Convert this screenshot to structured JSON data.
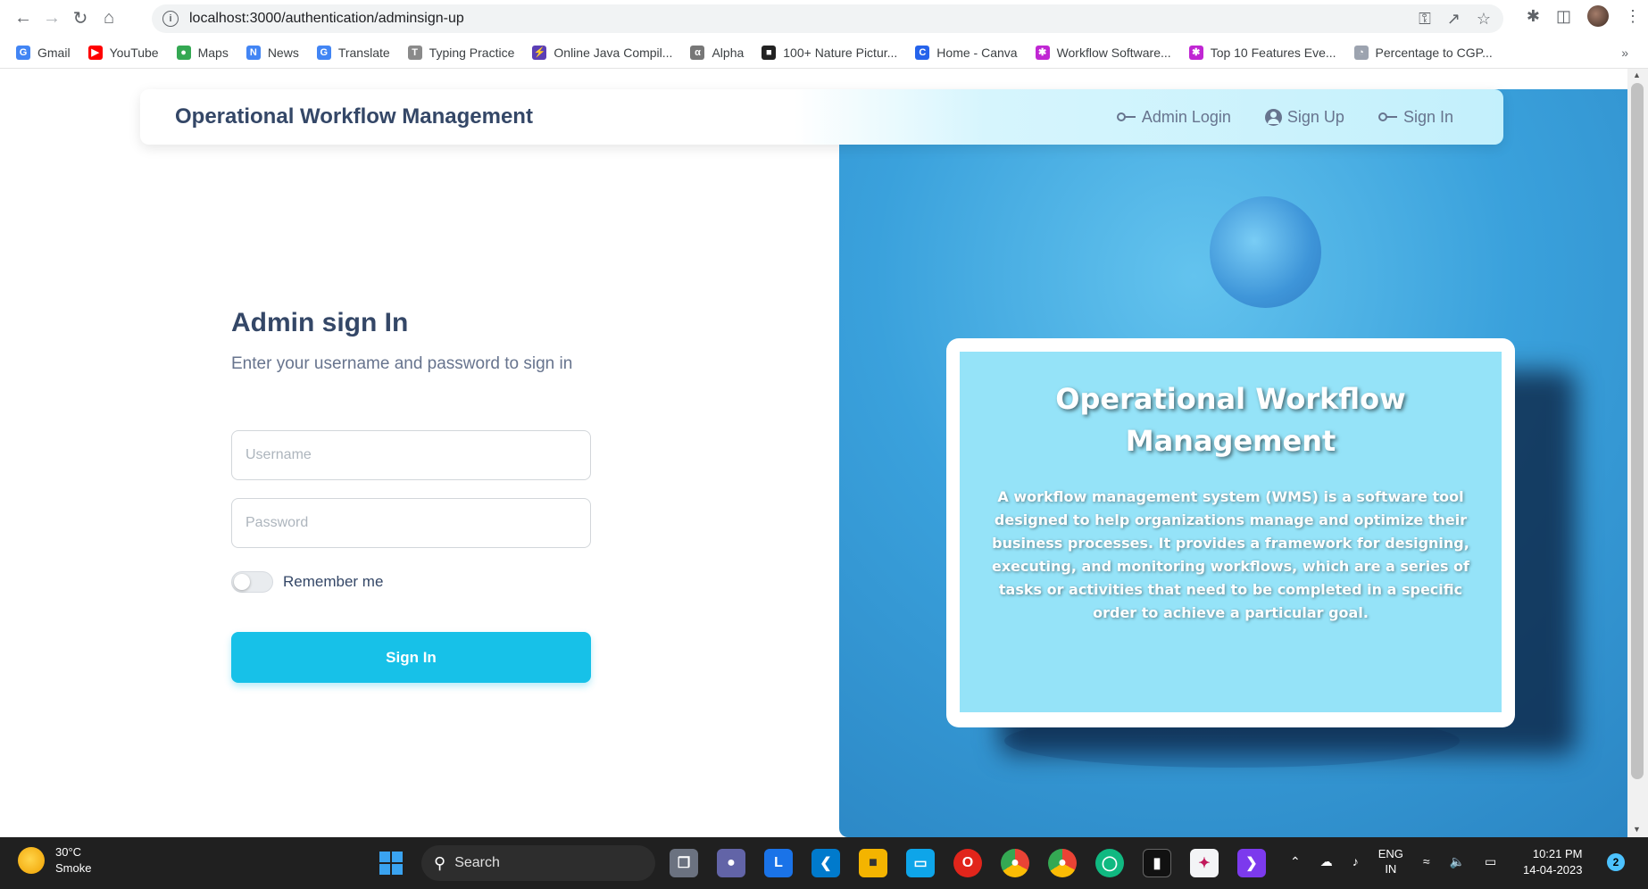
{
  "browser": {
    "url": "localhost:3000/authentication/adminsign-up",
    "bookmarks": [
      {
        "label": "Gmail",
        "icon": "G",
        "color": "#4285f4"
      },
      {
        "label": "YouTube",
        "icon": "▶",
        "color": "#ff0000"
      },
      {
        "label": "Maps",
        "icon": "●",
        "color": "#34a853"
      },
      {
        "label": "News",
        "icon": "N",
        "color": "#4285f4"
      },
      {
        "label": "Translate",
        "icon": "G",
        "color": "#4285f4"
      },
      {
        "label": "Typing Practice",
        "icon": "T",
        "color": "#8a8a8a"
      },
      {
        "label": "Online Java Compil...",
        "icon": "⚡",
        "color": "#5b3fb5"
      },
      {
        "label": "Alpha",
        "icon": "α",
        "color": "#777777"
      },
      {
        "label": "100+ Nature Pictur...",
        "icon": "■",
        "color": "#222222"
      },
      {
        "label": "Home - Canva",
        "icon": "C",
        "color": "#2563eb"
      },
      {
        "label": "Workflow Software...",
        "icon": "✱",
        "color": "#c026d3"
      },
      {
        "label": "Top 10 Features Eve...",
        "icon": "✱",
        "color": "#c026d3"
      },
      {
        "label": "Percentage to CGP...",
        "icon": "◔",
        "color": "#9ca3af"
      }
    ],
    "more": "»"
  },
  "navbar": {
    "brand": "Operational Workflow Management",
    "links": [
      "Admin Login",
      "Sign Up",
      "Sign In"
    ]
  },
  "form": {
    "title": "Admin sign In",
    "subtitle": "Enter your username and password to sign in",
    "username_placeholder": "Username",
    "password_placeholder": "Password",
    "remember_label": "Remember me",
    "remember_checked": false,
    "submit_label": "Sign In"
  },
  "card": {
    "title": "Operational Workflow Management",
    "text": "A workflow management system (WMS) is a software tool designed to help organizations manage and optimize their business processes. It provides a framework for designing, executing, and monitoring workflows, which are a series of tasks or activities that need to be completed in a specific order to achieve a particular goal."
  },
  "taskbar": {
    "weather_temp": "30°C",
    "weather_desc": "Smoke",
    "search_label": "Search",
    "lang_line1": "ENG",
    "lang_line2": "IN",
    "time": "10:21 PM",
    "date": "14-04-2023",
    "notification_count": "2"
  },
  "colors": {
    "primary": "#17c1e8",
    "heading": "#344767",
    "muted": "#67748e",
    "card_bg": "#95e3f8"
  }
}
